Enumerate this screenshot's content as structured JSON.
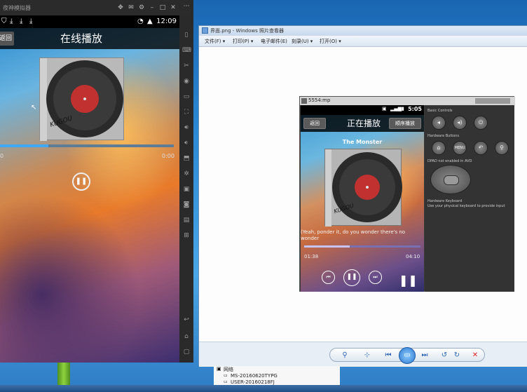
{
  "emulator": {
    "window_title": "夜神模拟器",
    "status_time": "12:09",
    "header_title": "在线播放",
    "back_label": "返回",
    "time_left": "0",
    "time_right": "0:00",
    "cover_text": "KUGOU",
    "seek_progress": 0.28
  },
  "viewer": {
    "title": "界面.png - Windows 照片查看器",
    "menu": [
      "文件(F) ▾",
      "打印(P) ▾",
      "电子邮件(E)",
      "刻录(U) ▾",
      "打开(O) ▾"
    ]
  },
  "inner": {
    "window_title": "5554:mp",
    "status_time": "5:05",
    "back_button": "返回",
    "header_title": "正在播放",
    "order_button": "顺序播放",
    "song_title": "The Monster",
    "cover_text": "KUGOU",
    "lyric": "(Yeah, ponder it, do you wonder there's no wonder",
    "time_current": "01:38",
    "time_total": "04:10",
    "seek_progress": 0.39,
    "controls": {
      "basic_label": "Basic Controls",
      "hardware_label": "Hardware Buttons",
      "dpad_label": "DPAD not enabled in AVD",
      "keyboard_label": "Hardware Keyboard",
      "keyboard_hint": "Use your physical keyboard to provide input"
    }
  },
  "network": {
    "label": "网络",
    "items": [
      "MS-20160620TYPG",
      "USER-20160218FJ"
    ]
  }
}
